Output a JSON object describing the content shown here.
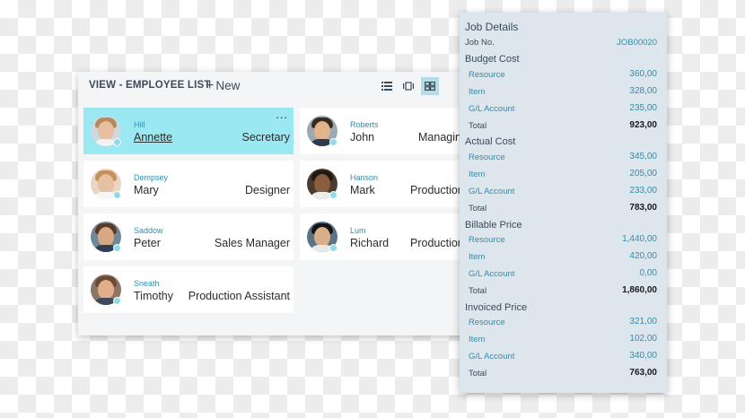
{
  "employee_list": {
    "title": "VIEW - EMPLOYEE LIST",
    "new_label": "New",
    "view_modes": [
      "list-view-icon",
      "tile-view-icon",
      "brick-view-icon"
    ],
    "employees": [
      {
        "last": "Hill",
        "first": "Annette",
        "title": "Secretary",
        "selected": true
      },
      {
        "last": "Roberts",
        "first": "John",
        "title": "Managing"
      },
      {
        "last": "Dempsey",
        "first": "Mary",
        "title": "Designer"
      },
      {
        "last": "Hanson",
        "first": "Mark",
        "title": "Production"
      },
      {
        "last": "Saddow",
        "first": "Peter",
        "title": "Sales Manager"
      },
      {
        "last": "Lum",
        "first": "Richard",
        "title": "Production"
      },
      {
        "last": "Sneath",
        "first": "Timothy",
        "title": "Production Assistant"
      }
    ],
    "more_label": "..."
  },
  "job_details": {
    "title": "Job Details",
    "job_no_label": "Job No.",
    "job_no": "JOB00020",
    "sections": [
      {
        "heading": "Budget Cost",
        "rows": [
          {
            "label": "Resource",
            "value": "360,00"
          },
          {
            "label": "Item",
            "value": "328,00"
          },
          {
            "label": "G/L Account",
            "value": "235,00"
          },
          {
            "label": "Total",
            "value": "923,00"
          }
        ]
      },
      {
        "heading": "Actual Cost",
        "rows": [
          {
            "label": "Resource",
            "value": "345,00"
          },
          {
            "label": "Item",
            "value": "205,00"
          },
          {
            "label": "G/L Account",
            "value": "233,00"
          },
          {
            "label": "Total",
            "value": "783,00"
          }
        ]
      },
      {
        "heading": "Billable Price",
        "rows": [
          {
            "label": "Resource",
            "value": "1,440,00"
          },
          {
            "label": "Item",
            "value": "420,00"
          },
          {
            "label": "G/L Account",
            "value": "0,00"
          },
          {
            "label": "Total",
            "value": "1,860,00"
          }
        ]
      },
      {
        "heading": "Invoiced Price",
        "rows": [
          {
            "label": "Resource",
            "value": "321,00"
          },
          {
            "label": "Item",
            "value": "102,00"
          },
          {
            "label": "G/L Account",
            "value": "340,00"
          },
          {
            "label": "Total",
            "value": "763,00"
          }
        ]
      }
    ]
  },
  "colors": {
    "accent": "#2f8fb0",
    "selected_card": "#9ae9f2",
    "status_dot": "#8fdbe8"
  }
}
